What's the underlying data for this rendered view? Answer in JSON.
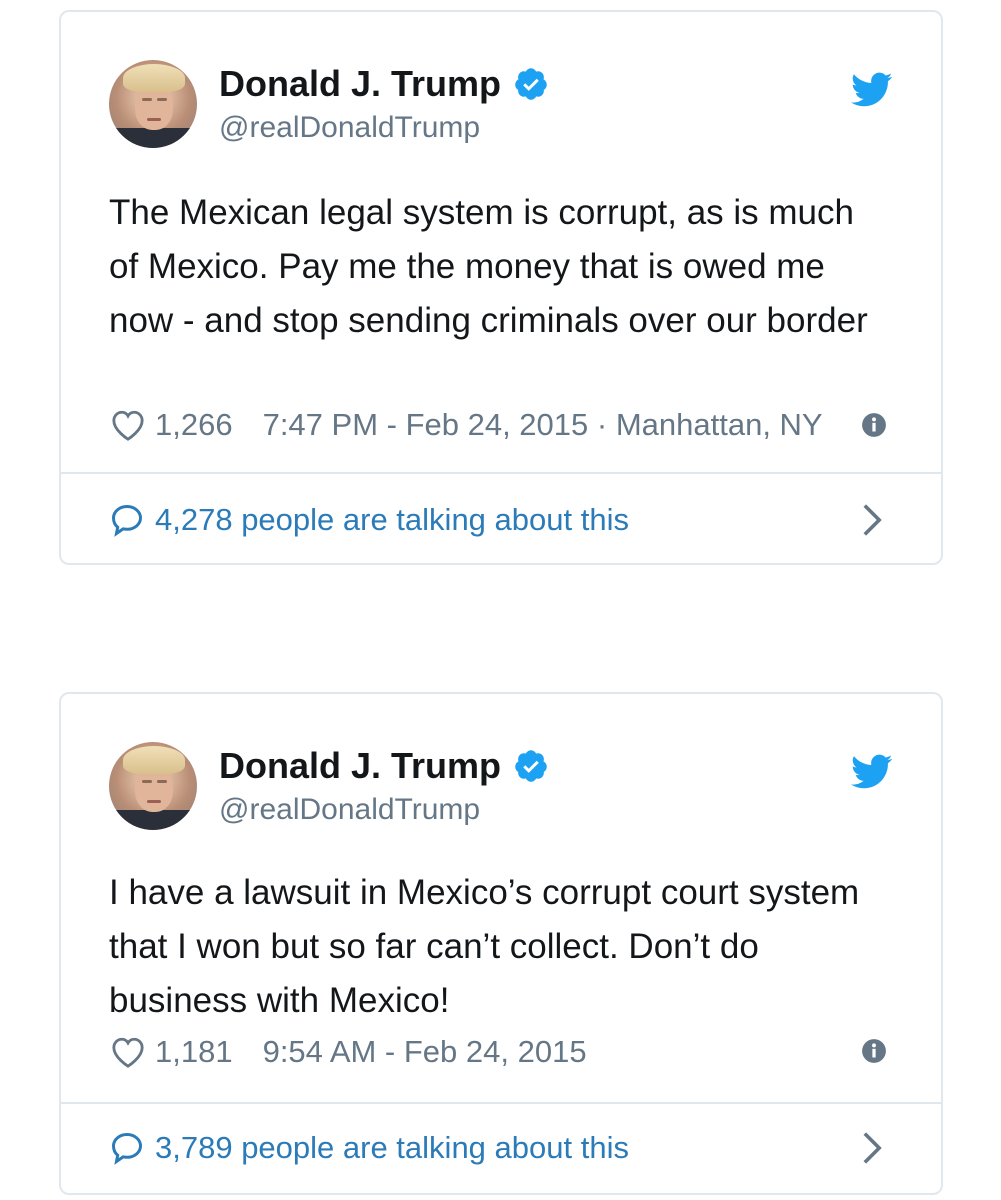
{
  "tweets": [
    {
      "name": "Donald J. Trump",
      "handle": "@realDonaldTrump",
      "text": "The Mexican legal system is corrupt, as is much of Mexico. Pay me the money that is owed me now - and stop sending criminals over our border",
      "likes": "1,266",
      "timestamp": "7:47 PM - Feb 24, 2015 · Manhattan, NY",
      "talking": "4,278 people are talking about this"
    },
    {
      "name": "Donald J. Trump",
      "handle": "@realDonaldTrump",
      "text": "I have a lawsuit in Mexico’s corrupt court system that I won but so far can’t collect. Don’t do business with Mexico!",
      "likes": "1,181",
      "timestamp": "9:54 AM - Feb 24, 2015",
      "talking": "3,789 people are talking about this"
    }
  ],
  "icons": {
    "verified": "verified-badge-icon",
    "bird": "twitter-bird-icon",
    "heart": "heart-icon",
    "info": "info-icon",
    "comment": "speech-bubble-icon",
    "chevron": "chevron-right-icon"
  },
  "colors": {
    "brand_blue": "#1da1f2",
    "link_blue": "#2b7bb9",
    "text": "#14171a",
    "muted": "#657786",
    "border": "#e1e8ed"
  }
}
